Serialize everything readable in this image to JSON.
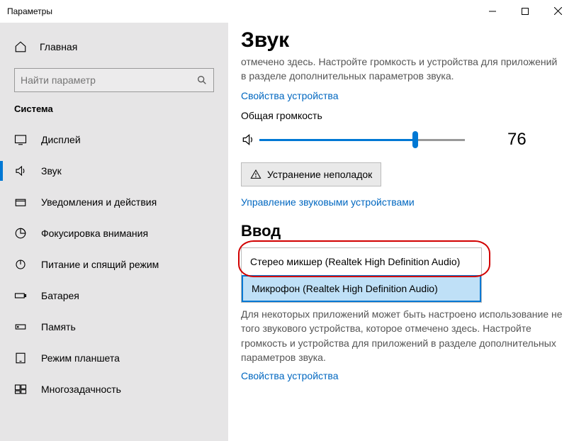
{
  "window": {
    "title": "Параметры"
  },
  "sidebar": {
    "home": "Главная",
    "search_placeholder": "Найти параметр",
    "section": "Система",
    "items": [
      {
        "label": "Дисплей"
      },
      {
        "label": "Звук"
      },
      {
        "label": "Уведомления и действия"
      },
      {
        "label": "Фокусировка внимания"
      },
      {
        "label": "Питание и спящий режим"
      },
      {
        "label": "Батарея"
      },
      {
        "label": "Память"
      },
      {
        "label": "Режим планшета"
      },
      {
        "label": "Многозадачность"
      }
    ]
  },
  "content": {
    "title": "Звук",
    "truncated_top": "отмечено здесь. Настройте громкость и устройства для приложений в разделе дополнительных параметров звука.",
    "link1": "Свойства устройства",
    "volume_label": "Общая громкость",
    "volume_value": "76",
    "volume_percent": 76,
    "troubleshoot": "Устранение неполадок",
    "manage_link": "Управление звуковыми устройствами",
    "input_heading": "Ввод",
    "input_options": [
      {
        "label": "Стерео микшер (Realtek High Definition Audio)"
      },
      {
        "label": "Микрофон (Realtek High Definition Audio)"
      }
    ],
    "input_desc": "Для некоторых приложений может быть настроено использование не того звукового устройства, которое отмечено здесь. Настройте громкость и устройства для приложений в разделе дополнительных параметров звука.",
    "link2": "Свойства устройства"
  }
}
